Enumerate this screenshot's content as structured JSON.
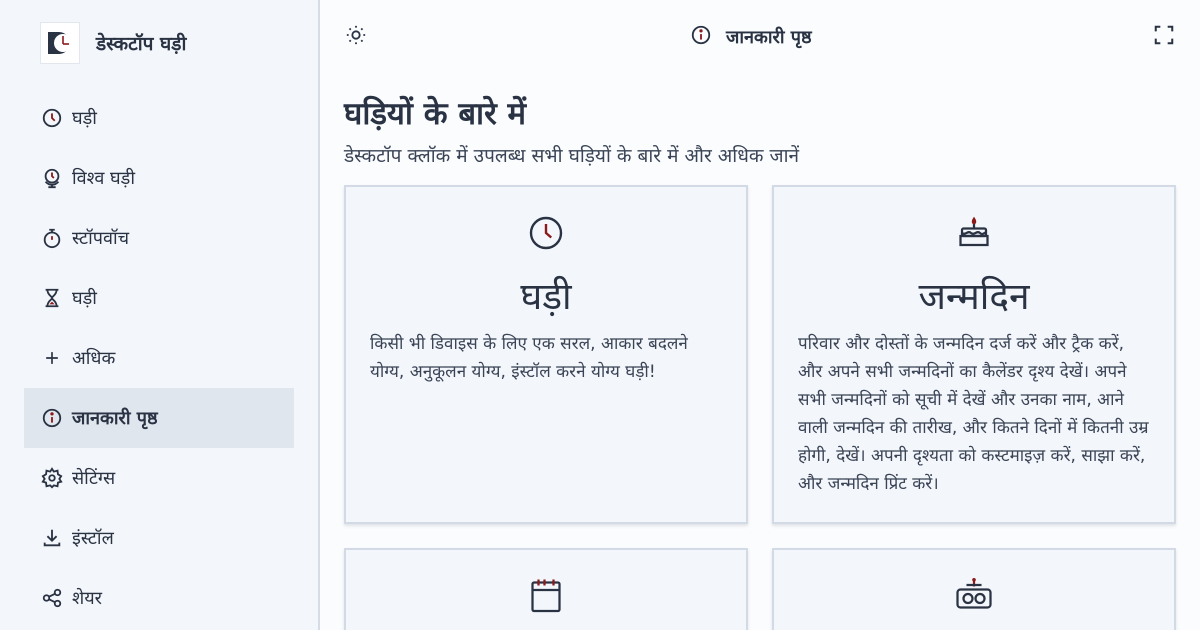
{
  "app": {
    "title": "डेस्कटॉप घड़ी"
  },
  "sidebar": {
    "items": [
      {
        "label": "घड़ी",
        "icon": "clock-icon"
      },
      {
        "label": "विश्व घड़ी",
        "icon": "globe-clock-icon"
      },
      {
        "label": "स्टॉपवॉच",
        "icon": "stopwatch-icon"
      },
      {
        "label": "घड़ी",
        "icon": "hourglass-icon"
      },
      {
        "label": "अधिक",
        "icon": "plus-icon"
      },
      {
        "label": "जानकारी पृष्ठ",
        "icon": "info-icon",
        "active": true
      },
      {
        "label": "सेटिंग्स",
        "icon": "gear-icon"
      },
      {
        "label": "इंस्टॉल",
        "icon": "download-icon"
      },
      {
        "label": "शेयर",
        "icon": "share-icon"
      }
    ]
  },
  "topbar": {
    "title": "जानकारी पृष्ठ"
  },
  "page": {
    "heading": "घड़ियों के बारे में",
    "subheading": "डेस्कटॉप क्लॉक में उपलब्ध सभी घड़ियों के बारे में और अधिक जानें"
  },
  "cards": [
    {
      "title": "घड़ी",
      "icon": "clock-icon",
      "desc": "किसी भी डिवाइस के लिए एक सरल, आकार बदलने योग्य, अनुकूलन योग्य, इंस्टॉल करने योग्य घड़ी!"
    },
    {
      "title": "जन्मदिन",
      "icon": "birthday-cake-icon",
      "desc": "परिवार और दोस्तों के जन्मदिन दर्ज करें और ट्रैक करें, और अपने सभी जन्मदिनों का कैलेंडर दृश्य देखें। अपने सभी जन्मदिनों को सूची में देखें और उनका नाम, आने वाली जन्मदिन की तारीख, और कितने दिनों में कितनी उम्र होगी, देखें। अपनी दृश्यता को कस्टमाइज़ करें, साझा करें, और जन्मदिन प्रिंट करें।"
    },
    {
      "icon": "calendar-icon"
    },
    {
      "icon": "alarm-clock-icon"
    }
  ],
  "colors": {
    "accent": "#8b1a1a",
    "text": "#2a3344",
    "sidebar_bg": "#f3f6fa",
    "active_bg": "#e0e6ee"
  }
}
